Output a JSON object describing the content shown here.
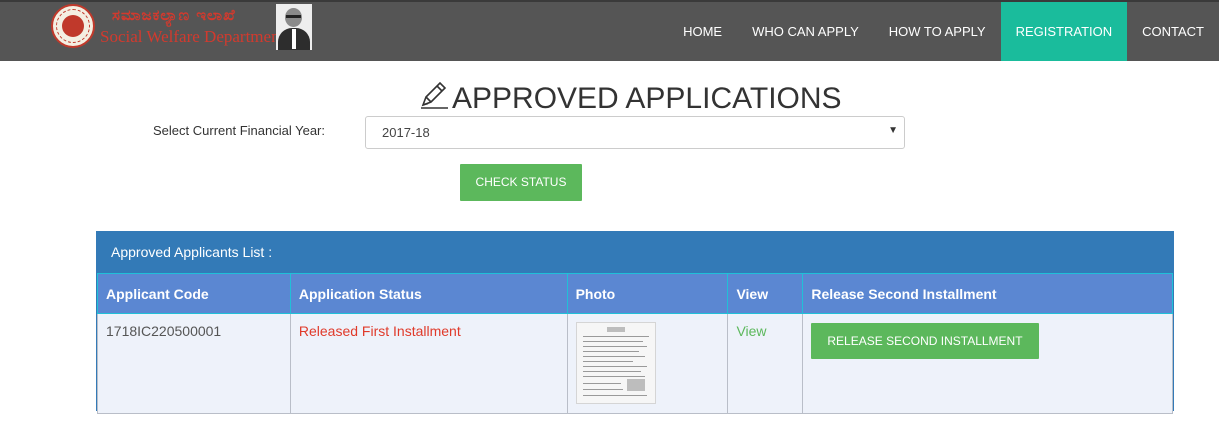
{
  "header": {
    "kannada_title": "ಸಮಾಜಕಲ್ಯಾಣ ಇಲಾಖೆ",
    "department_name": "Social Welfare Department",
    "nav": [
      {
        "label": "HOME",
        "active": false
      },
      {
        "label": "WHO CAN APPLY",
        "active": false
      },
      {
        "label": "HOW TO APPLY",
        "active": false
      },
      {
        "label": "REGISTRATION",
        "active": true
      },
      {
        "label": "CONTACT",
        "active": false
      }
    ],
    "active_color": "#1abc9c"
  },
  "page": {
    "title": "APPROVED APPLICATIONS",
    "financial_year_label": "Select Current Financial Year:",
    "financial_year_value": "2017-18",
    "check_status_label": "CHECK STATUS"
  },
  "panel": {
    "heading": "Approved Applicants List :",
    "columns": [
      "Applicant Code",
      "Application Status",
      "Photo",
      "View",
      "Release Second Installment"
    ],
    "rows": [
      {
        "applicant_code": "1718IC220500001",
        "status": "Released First Installment",
        "view_label": "View",
        "action_label": "RELEASE SECOND INSTALLMENT"
      }
    ]
  },
  "colors": {
    "navbar": "#555555",
    "primary": "#337ab7",
    "table_header": "#5b87d2",
    "success": "#5cb85c",
    "status_text": "#e03a2a"
  },
  "icons": [
    "pencil-icon",
    "emblem-logo",
    "dropdown-caret-icon"
  ]
}
